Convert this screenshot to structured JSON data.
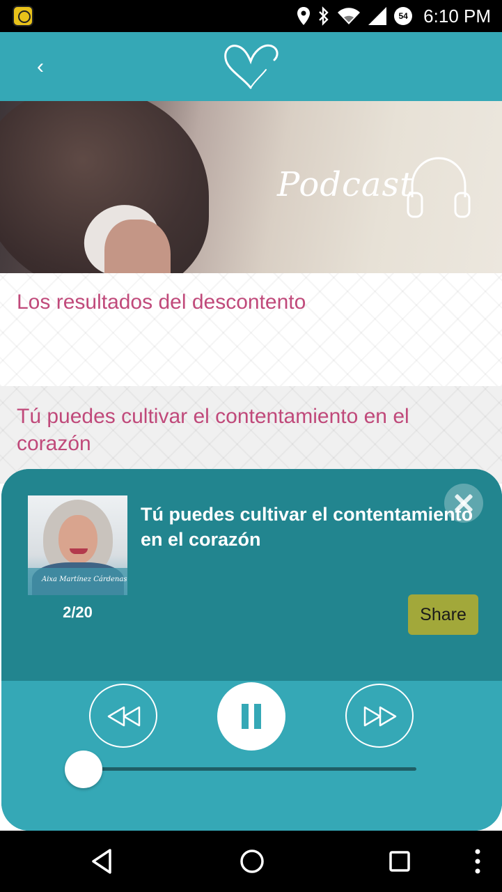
{
  "status_bar": {
    "time": "6:10 PM",
    "notification_badge": "54",
    "icons": [
      "app-notification-icon",
      "location-icon",
      "bluetooth-icon",
      "wifi-icon",
      "signal-icon",
      "badge-icon"
    ]
  },
  "app_bar": {
    "back_icon": "chevron-left-icon",
    "logo_icon": "heart-logo-icon",
    "back_symbol": "‹"
  },
  "hero": {
    "label": "Podcast",
    "icon": "headphones-icon"
  },
  "episodes": [
    {
      "title": "Los resultados del descontento"
    },
    {
      "title": "Tú puedes cultivar el contentamiento en el corazón"
    }
  ],
  "player": {
    "track_title": "Tú puedes cultivar el contentamiento en el corazón",
    "track_counter": "2/20",
    "artwork_caption": "Aixa Martínez Cárdenas",
    "share_label": "Share",
    "progress": 0.0,
    "state": "playing",
    "colors": {
      "panel": "#22858f",
      "controls": "#35a8b6",
      "share": "#a2a83a",
      "title_accent": "#c0497a"
    }
  },
  "nav_bar": {
    "icons": [
      "back-triangle-icon",
      "home-circle-icon",
      "recents-square-icon",
      "more-vert-icon"
    ]
  }
}
